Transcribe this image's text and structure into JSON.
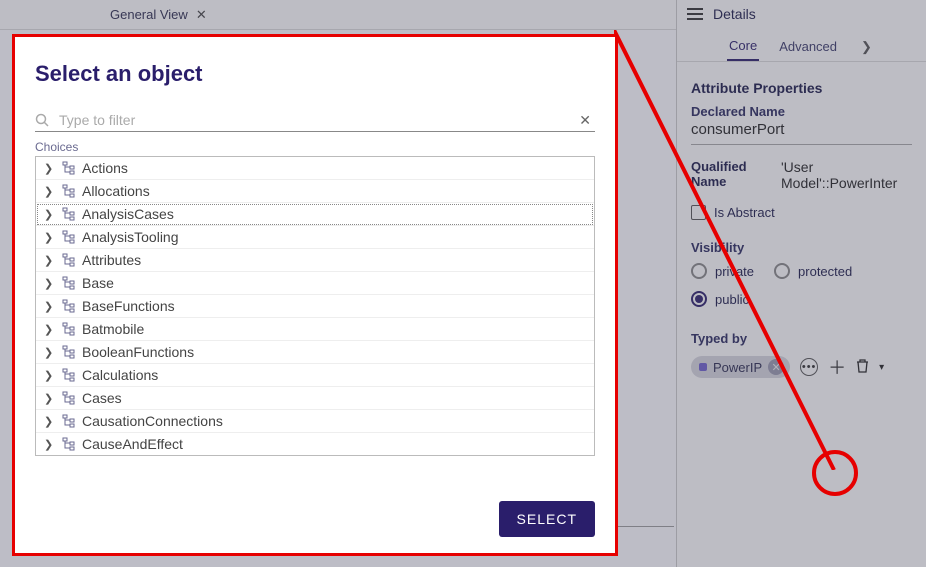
{
  "topTab": {
    "label": "General View"
  },
  "rightPanel": {
    "title": "Details",
    "tabs": {
      "core": "Core",
      "advanced": "Advanced"
    },
    "sectionTitle": "Attribute Properties",
    "declaredNameLabel": "Declared Name",
    "declaredNameValue": "consumerPort",
    "qualifiedNameLabel": "Qualified Name",
    "qualifiedNameValue": "'User Model'::PowerInter",
    "isAbstractLabel": "Is Abstract",
    "visibilityLabel": "Visibility",
    "visibility": {
      "private": "private",
      "protected": "protected",
      "public": "public"
    },
    "typedByLabel": "Typed by",
    "typedByChip": "PowerIP"
  },
  "modal": {
    "title": "Select an object",
    "filterPlaceholder": "Type to filter",
    "choicesLabel": "Choices",
    "selectButton": "SELECT",
    "items": [
      {
        "label": "Actions"
      },
      {
        "label": "Allocations"
      },
      {
        "label": "AnalysisCases",
        "selected": true
      },
      {
        "label": "AnalysisTooling"
      },
      {
        "label": "Attributes"
      },
      {
        "label": "Base"
      },
      {
        "label": "BaseFunctions"
      },
      {
        "label": "Batmobile"
      },
      {
        "label": "BooleanFunctions"
      },
      {
        "label": "Calculations"
      },
      {
        "label": "Cases"
      },
      {
        "label": "CausationConnections"
      },
      {
        "label": "CauseAndEffect"
      }
    ]
  }
}
